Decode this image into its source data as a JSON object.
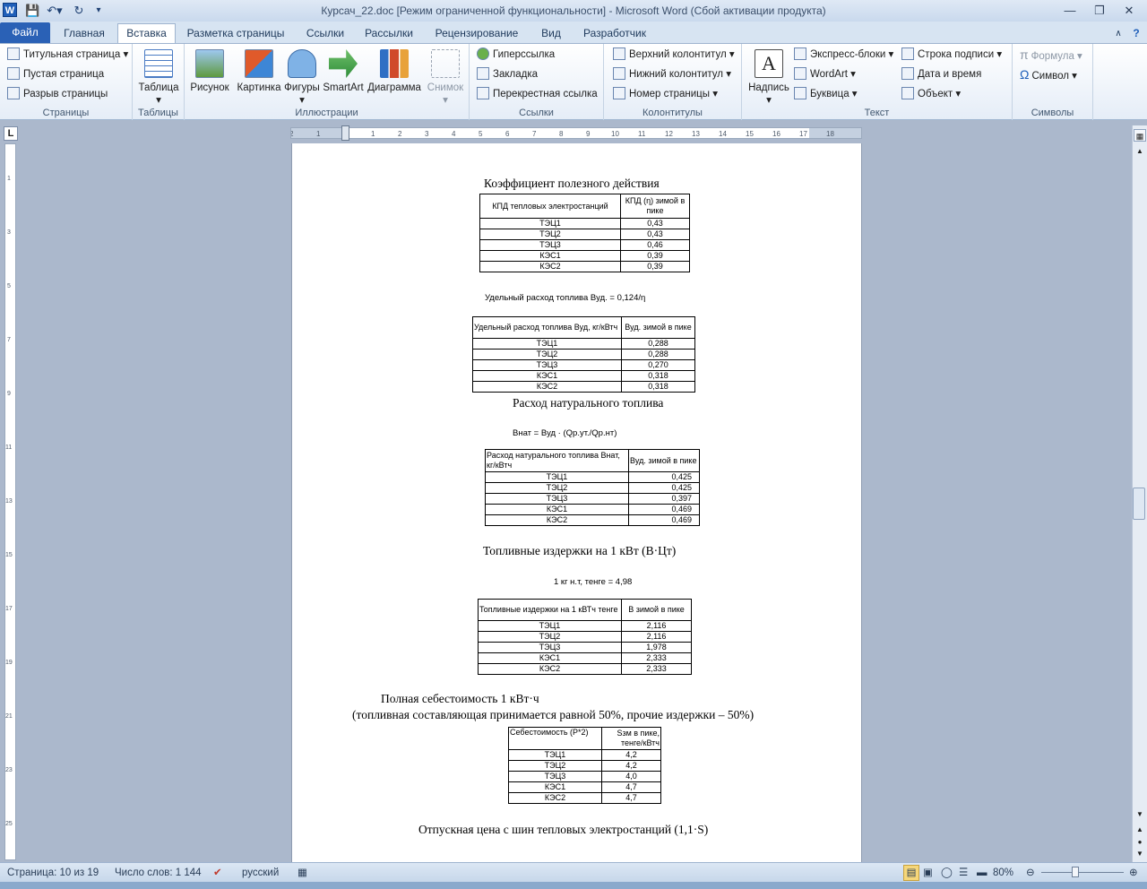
{
  "window": {
    "title": "Курсач_22.doc [Режим ограниченной функциональности]  -  Microsoft Word (Сбой активации продукта)"
  },
  "tabs": [
    "Файл",
    "Главная",
    "Вставка",
    "Разметка страницы",
    "Ссылки",
    "Рассылки",
    "Рецензирование",
    "Вид",
    "Разработчик"
  ],
  "ribbon": {
    "pages": {
      "items": [
        "Титульная страница",
        "Пустая страница",
        "Разрыв страницы"
      ],
      "label": "Страницы"
    },
    "tables": {
      "button": "Таблица",
      "label": "Таблицы"
    },
    "illustrations": {
      "buttons": [
        "Рисунок",
        "Картинка",
        "Фигуры",
        "SmartArt",
        "Диаграмма",
        "Снимок"
      ],
      "label": "Иллюстрации"
    },
    "links": {
      "items": [
        "Гиперссылка",
        "Закладка",
        "Перекрестная ссылка"
      ],
      "label": "Ссылки"
    },
    "headers": {
      "items": [
        "Верхний колонтитул",
        "Нижний колонтитул",
        "Номер страницы"
      ],
      "label": "Колонтитулы"
    },
    "text": {
      "button": "Надпись",
      "items1": [
        "Экспресс-блоки",
        "WordArt",
        "Буквица"
      ],
      "items2": [
        "Строка подписи",
        "Дата и время",
        "Объект"
      ],
      "label": "Текст"
    },
    "symbols": {
      "items": [
        "Формула",
        "Символ"
      ],
      "label": "Символы"
    }
  },
  "doc": {
    "s1": {
      "title": "Коэффициент полезного действия",
      "head": [
        "КПД тепловых электростанций",
        "КПД (η) зимой в пике"
      ],
      "rows": [
        [
          "ТЭЦ1",
          "0,43"
        ],
        [
          "ТЭЦ2",
          "0,43"
        ],
        [
          "ТЭЦ3",
          "0,46"
        ],
        [
          "КЭС1",
          "0,39"
        ],
        [
          "КЭС2",
          "0,39"
        ]
      ]
    },
    "s2": {
      "formula": "Удельный расход топлива Вуд.  = 0,124/η",
      "head": [
        "Удельный расход топлива Вуд, кг/кВтч",
        "Вуд. зимой в пике"
      ],
      "rows": [
        [
          "ТЭЦ1",
          "0,288"
        ],
        [
          "ТЭЦ2",
          "0,288"
        ],
        [
          "ТЭЦ3",
          "0,270"
        ],
        [
          "КЭС1",
          "0,318"
        ],
        [
          "КЭС2",
          "0,318"
        ]
      ]
    },
    "s3": {
      "title": "Расход натурального топлива",
      "formula": "Внат = Вуд · (Qр.ут./Qр.нт)",
      "head": [
        "Расход натурального топлива Внат, кг/кВтч",
        "Вуд. зимой в пике"
      ],
      "rows": [
        [
          "ТЭЦ1",
          "0,425"
        ],
        [
          "ТЭЦ2",
          "0,425"
        ],
        [
          "ТЭЦ3",
          "0,397"
        ],
        [
          "КЭС1",
          "0,469"
        ],
        [
          "КЭС2",
          "0,469"
        ]
      ]
    },
    "s4": {
      "title": "Топливные издержки на 1 кВт (В·Цт)",
      "formula": "1 кг н.т, тенге = 4,98",
      "head": [
        "Топливные издержки на 1 кВТч тенге",
        "В зимой в пике"
      ],
      "rows": [
        [
          "ТЭЦ1",
          "2,116"
        ],
        [
          "ТЭЦ2",
          "2,116"
        ],
        [
          "ТЭЦ3",
          "1,978"
        ],
        [
          "КЭС1",
          "2,333"
        ],
        [
          "КЭС2",
          "2,333"
        ]
      ]
    },
    "s5": {
      "title": "Полная себестоимость 1 кВт·ч",
      "subtitle": "(топливная составляющая принимается равной 50%, прочие издержки – 50%)",
      "head": [
        "Себестоимость (Р*2)",
        "Sзм в пике, тенге/кВтч"
      ],
      "rows": [
        [
          "ТЭЦ1",
          "4,2"
        ],
        [
          "ТЭЦ2",
          "4,2"
        ],
        [
          "ТЭЦ3",
          "4,0"
        ],
        [
          "КЭС1",
          "4,7"
        ],
        [
          "КЭС2",
          "4,7"
        ]
      ]
    },
    "s6": {
      "title": "Отпускная цена с шин тепловых электростанций (1,1·S)"
    }
  },
  "statusbar": {
    "page": "Страница: 10 из 19",
    "words": "Число слов: 1 144",
    "language": "русский",
    "zoom": "80%"
  }
}
